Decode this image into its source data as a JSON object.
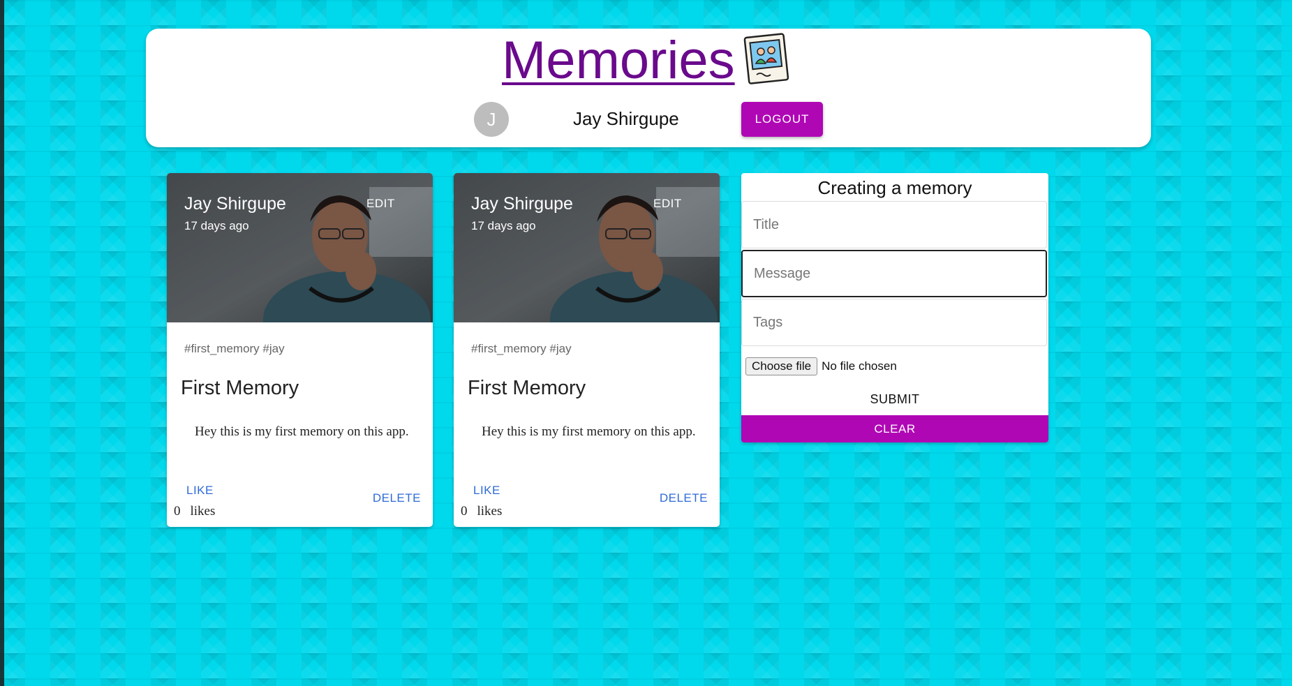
{
  "header": {
    "brand_title": "Memories",
    "avatar_initial": "J",
    "username": "Jay Shirgupe",
    "logout_label": "LOGOUT"
  },
  "posts": [
    {
      "author": "Jay Shirgupe",
      "time": "17 days ago",
      "edit_label": "EDIT",
      "tags": "#first_memory #jay",
      "title": "First Memory",
      "message": "Hey this is my first memory on this app.",
      "like_label": "LIKE",
      "likes_count": "0",
      "likes_word": "likes",
      "delete_label": "DELETE"
    },
    {
      "author": "Jay Shirgupe",
      "time": "17 days ago",
      "edit_label": "EDIT",
      "tags": "#first_memory #jay",
      "title": "First Memory",
      "message": "Hey this is my first memory on this app.",
      "like_label": "LIKE",
      "likes_count": "0",
      "likes_word": "likes",
      "delete_label": "DELETE"
    }
  ],
  "form": {
    "heading": "Creating a memory",
    "title_placeholder": "Title",
    "message_placeholder": "Message",
    "tags_placeholder": "Tags",
    "file_button_label": "Choose file",
    "file_status": "No file chosen",
    "submit_label": "SUBMIT",
    "clear_label": "CLEAR"
  },
  "colors": {
    "background": "#00d9ec",
    "brand_title": "#6a0a8c",
    "accent_purple": "#b007b5",
    "link_blue": "#2f6bd6",
    "avatar_gray": "#bdbdbd"
  },
  "icons": {
    "brand_logo": "photo-frame-icon",
    "card_media": "photo-thumbnail"
  }
}
